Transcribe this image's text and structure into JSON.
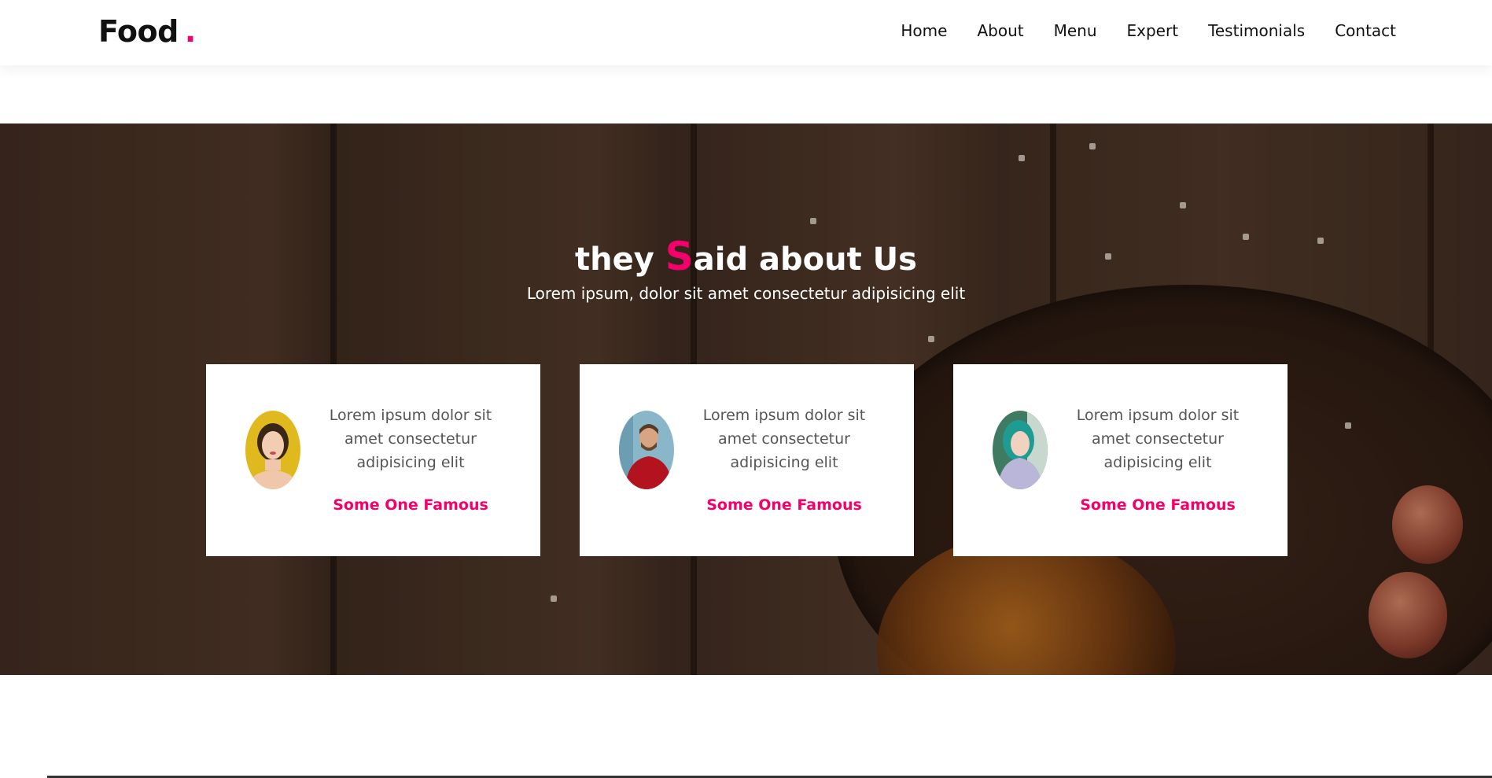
{
  "header": {
    "logo": "Food",
    "logo_dot": ".",
    "nav": [
      "Home",
      "About",
      "Menu",
      "Expert",
      "Testimonials",
      "Contact"
    ]
  },
  "testimonials": {
    "title_before": "they ",
    "title_accent": "S",
    "title_after": "aid about Us",
    "subtitle": "Lorem ipsum, dolor sit amet consectetur adipisicing elit",
    "cards": [
      {
        "text": "Lorem ipsum dolor sit amet consectetur adipisicing elit",
        "name": "Some One Famous",
        "avatar": "woman-yellow-avatar"
      },
      {
        "text": "Lorem ipsum dolor sit amet consectetur adipisicing elit",
        "name": "Some One Famous",
        "avatar": "man-red-avatar"
      },
      {
        "text": "Lorem ipsum dolor sit amet consectetur adipisicing elit",
        "name": "Some One Famous",
        "avatar": "woman-teal-avatar"
      }
    ]
  },
  "colors": {
    "accent": "#f5006b",
    "text_dark": "#111111",
    "card_text": "#555555"
  }
}
